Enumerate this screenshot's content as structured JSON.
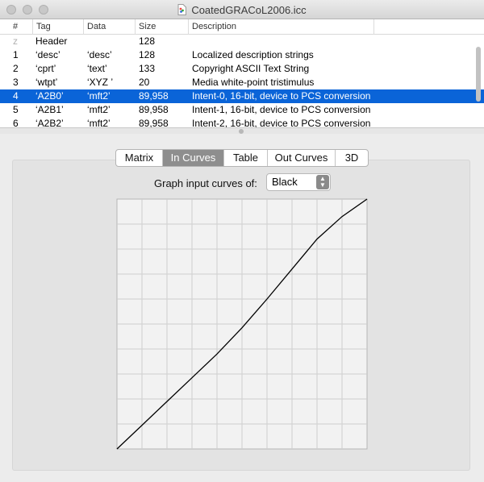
{
  "window": {
    "title": "CoatedGRACoL2006.icc"
  },
  "table": {
    "columns": [
      "#",
      "Tag",
      "Data",
      "Size",
      "Description"
    ],
    "rows": [
      {
        "num": "z",
        "tag": "Header",
        "data": "",
        "size": "128",
        "desc": ""
      },
      {
        "num": "1",
        "tag": "‘desc’",
        "data": "‘desc’",
        "size": "128",
        "desc": "Localized description strings"
      },
      {
        "num": "2",
        "tag": "‘cprt’",
        "data": "‘text’",
        "size": "133",
        "desc": "Copyright ASCII Text String"
      },
      {
        "num": "3",
        "tag": "‘wtpt’",
        "data": "‘XYZ ’",
        "size": "20",
        "desc": "Media white-point tristimulus"
      },
      {
        "num": "4",
        "tag": "‘A2B0’",
        "data": "‘mft2’",
        "size": "89,958",
        "desc": "Intent-0, 16-bit, device to PCS conversion"
      },
      {
        "num": "5",
        "tag": "‘A2B1’",
        "data": "‘mft2’",
        "size": "89,958",
        "desc": "Intent-1, 16-bit, device to PCS conversion"
      },
      {
        "num": "6",
        "tag": "‘A2B2’",
        "data": "‘mft2’",
        "size": "89,958",
        "desc": "Intent-2, 16-bit, device to PCS conversion"
      }
    ],
    "selected_row": 4
  },
  "tabs": [
    {
      "label": "Matrix",
      "active": false
    },
    {
      "label": "In Curves",
      "active": true
    },
    {
      "label": "Table",
      "active": false
    },
    {
      "label": "Out Curves",
      "active": false
    },
    {
      "label": "3D",
      "active": false
    }
  ],
  "curves": {
    "label": "Graph input curves of:",
    "channel": "Black"
  },
  "chart_data": {
    "type": "line",
    "title": "",
    "xlabel": "",
    "ylabel": "",
    "xlim": [
      0,
      1
    ],
    "ylim": [
      0,
      1
    ],
    "grid": true,
    "grid_divisions": 10,
    "series": [
      {
        "x": [
          0,
          0.1,
          0.2,
          0.3,
          0.4,
          0.5,
          0.6,
          0.7,
          0.8,
          0.9,
          1.0
        ],
        "values": [
          0,
          0.095,
          0.19,
          0.285,
          0.38,
          0.485,
          0.6,
          0.72,
          0.84,
          0.93,
          1.0
        ]
      }
    ],
    "colors": {
      "line": "#000000",
      "grid": "#cfcfcf",
      "background": "#f2f2f2"
    }
  }
}
